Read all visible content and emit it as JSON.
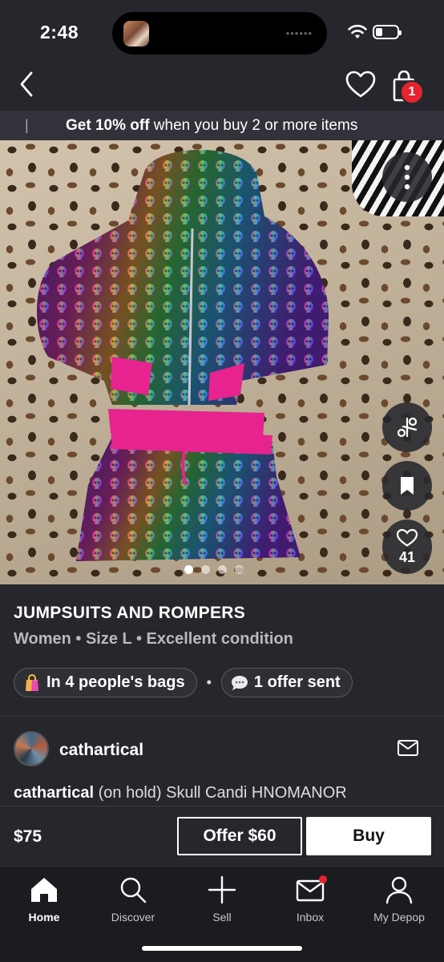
{
  "status_bar": {
    "time": "2:48",
    "island_dots": "••••••"
  },
  "nav": {
    "bag_count": "1"
  },
  "promo": {
    "bold": "Get 10% off",
    "rest": " when you buy 2 or more items",
    "separator": "|"
  },
  "product": {
    "like_count": "41",
    "image_count": 4,
    "active_image": 1,
    "title": "JUMPSUITS AND ROMPERS",
    "meta": "Women • Size L • Excellent condition",
    "chips": {
      "bags": "In 4 people's bags",
      "separator": "•",
      "offers": "1 offer sent"
    }
  },
  "seller": {
    "name": "cathartical"
  },
  "description": {
    "user": "cathartical",
    "text": " (on hold) Skull Candi HNOMANOR"
  },
  "buybar": {
    "price": "$75",
    "offer_label": "Offer $60",
    "buy_label": "Buy"
  },
  "tabs": [
    {
      "label": "Home"
    },
    {
      "label": "Discover"
    },
    {
      "label": "Sell"
    },
    {
      "label": "Inbox"
    },
    {
      "label": "My Depop"
    }
  ],
  "colors": {
    "background": "#26272d",
    "badge": "#e8232f",
    "chip_border": "#5a5b62",
    "tabbar": "#1b1c20",
    "accent_pink": "#e6238e"
  }
}
